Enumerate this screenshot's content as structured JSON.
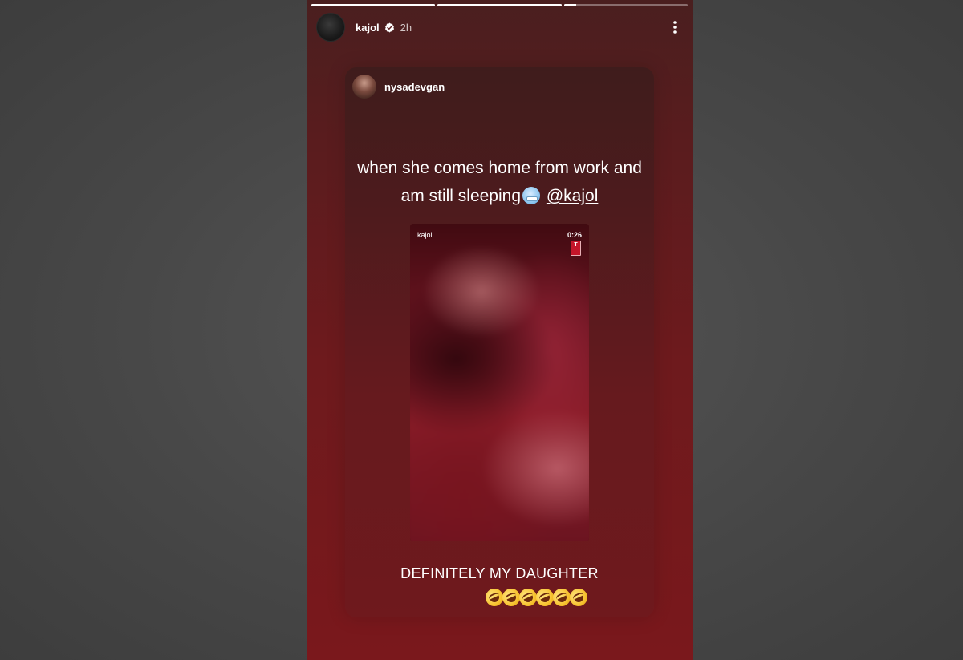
{
  "story": {
    "progress": [
      1.0,
      1.0,
      0.1
    ],
    "author": {
      "username": "kajol",
      "verified_icon": "verified-badge-icon",
      "time": "2h"
    },
    "more_icon": "more-vertical-icon",
    "reshare": {
      "username": "nysadevgan",
      "caption_line1": "when she comes home from work and",
      "caption_line2": "am still sleeping",
      "caption_emoji": "face-with-medical-mask-icon",
      "mention": "@kajol",
      "video": {
        "username": "kajol",
        "duration": "0:26",
        "badge_letter": "T",
        "badge_icon": "t-series-icon"
      }
    },
    "text_overlay": "DEFINITELY MY DAUGHTER",
    "emojis": [
      "rofl-icon",
      "rofl-icon",
      "rofl-icon",
      "rofl-icon",
      "rofl-icon",
      "rofl-icon"
    ]
  }
}
